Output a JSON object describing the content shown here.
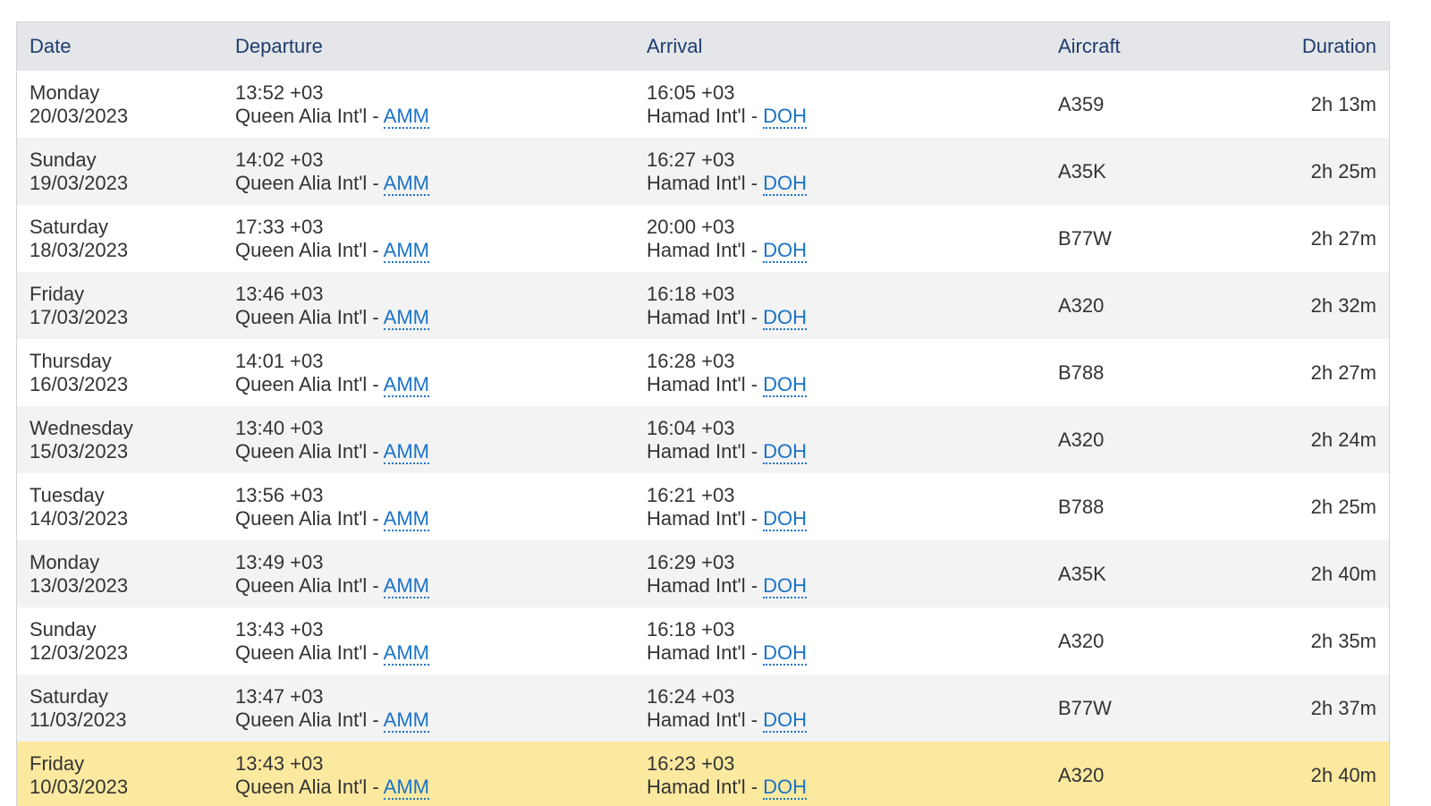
{
  "table": {
    "headers": {
      "date": "Date",
      "departure": "Departure",
      "arrival": "Arrival",
      "aircraft": "Aircraft",
      "duration": "Duration"
    },
    "rows": [
      {
        "day": "Monday",
        "date": "20/03/2023",
        "dep_time": "13:52 +03",
        "dep_airport": "Queen Alia Int'l - ",
        "dep_code": "AMM",
        "arr_time": "16:05 +03",
        "arr_airport": "Hamad Int'l - ",
        "arr_code": "DOH",
        "aircraft": "A359",
        "duration": "2h 13m"
      },
      {
        "day": "Sunday",
        "date": "19/03/2023",
        "dep_time": "14:02 +03",
        "dep_airport": "Queen Alia Int'l - ",
        "dep_code": "AMM",
        "arr_time": "16:27 +03",
        "arr_airport": "Hamad Int'l - ",
        "arr_code": "DOH",
        "aircraft": "A35K",
        "duration": "2h 25m"
      },
      {
        "day": "Saturday",
        "date": "18/03/2023",
        "dep_time": "17:33 +03",
        "dep_airport": "Queen Alia Int'l - ",
        "dep_code": "AMM",
        "arr_time": "20:00 +03",
        "arr_airport": "Hamad Int'l - ",
        "arr_code": "DOH",
        "aircraft": "B77W",
        "duration": "2h 27m"
      },
      {
        "day": "Friday",
        "date": "17/03/2023",
        "dep_time": "13:46 +03",
        "dep_airport": "Queen Alia Int'l - ",
        "dep_code": "AMM",
        "arr_time": "16:18 +03",
        "arr_airport": "Hamad Int'l - ",
        "arr_code": "DOH",
        "aircraft": "A320",
        "duration": "2h 32m"
      },
      {
        "day": "Thursday",
        "date": "16/03/2023",
        "dep_time": "14:01 +03",
        "dep_airport": "Queen Alia Int'l - ",
        "dep_code": "AMM",
        "arr_time": "16:28 +03",
        "arr_airport": "Hamad Int'l - ",
        "arr_code": "DOH",
        "aircraft": "B788",
        "duration": "2h 27m"
      },
      {
        "day": "Wednesday",
        "date": "15/03/2023",
        "dep_time": "13:40 +03",
        "dep_airport": "Queen Alia Int'l - ",
        "dep_code": "AMM",
        "arr_time": "16:04 +03",
        "arr_airport": "Hamad Int'l - ",
        "arr_code": "DOH",
        "aircraft": "A320",
        "duration": "2h 24m"
      },
      {
        "day": "Tuesday",
        "date": "14/03/2023",
        "dep_time": "13:56 +03",
        "dep_airport": "Queen Alia Int'l - ",
        "dep_code": "AMM",
        "arr_time": "16:21 +03",
        "arr_airport": "Hamad Int'l - ",
        "arr_code": "DOH",
        "aircraft": "B788",
        "duration": "2h 25m"
      },
      {
        "day": "Monday",
        "date": "13/03/2023",
        "dep_time": "13:49 +03",
        "dep_airport": "Queen Alia Int'l - ",
        "dep_code": "AMM",
        "arr_time": "16:29 +03",
        "arr_airport": "Hamad Int'l - ",
        "arr_code": "DOH",
        "aircraft": "A35K",
        "duration": "2h 40m"
      },
      {
        "day": "Sunday",
        "date": "12/03/2023",
        "dep_time": "13:43 +03",
        "dep_airport": "Queen Alia Int'l - ",
        "dep_code": "AMM",
        "arr_time": "16:18 +03",
        "arr_airport": "Hamad Int'l - ",
        "arr_code": "DOH",
        "aircraft": "A320",
        "duration": "2h 35m"
      },
      {
        "day": "Saturday",
        "date": "11/03/2023",
        "dep_time": "13:47 +03",
        "dep_airport": "Queen Alia Int'l - ",
        "dep_code": "AMM",
        "arr_time": "16:24 +03",
        "arr_airport": "Hamad Int'l - ",
        "arr_code": "DOH",
        "aircraft": "B77W",
        "duration": "2h 37m"
      },
      {
        "day": "Friday",
        "date": "10/03/2023",
        "dep_time": "13:43 +03",
        "dep_airport": "Queen Alia Int'l - ",
        "dep_code": "AMM",
        "arr_time": "16:23 +03",
        "arr_airport": "Hamad Int'l - ",
        "arr_code": "DOH",
        "aircraft": "A320",
        "duration": "2h 40m",
        "highlighted": true
      }
    ]
  },
  "colors": {
    "header_bg": "#e4e6e9",
    "header_text": "#1f3c6e",
    "link": "#1a73c8",
    "stripe": "#f3f3f3",
    "highlight": "#fbe99f"
  }
}
